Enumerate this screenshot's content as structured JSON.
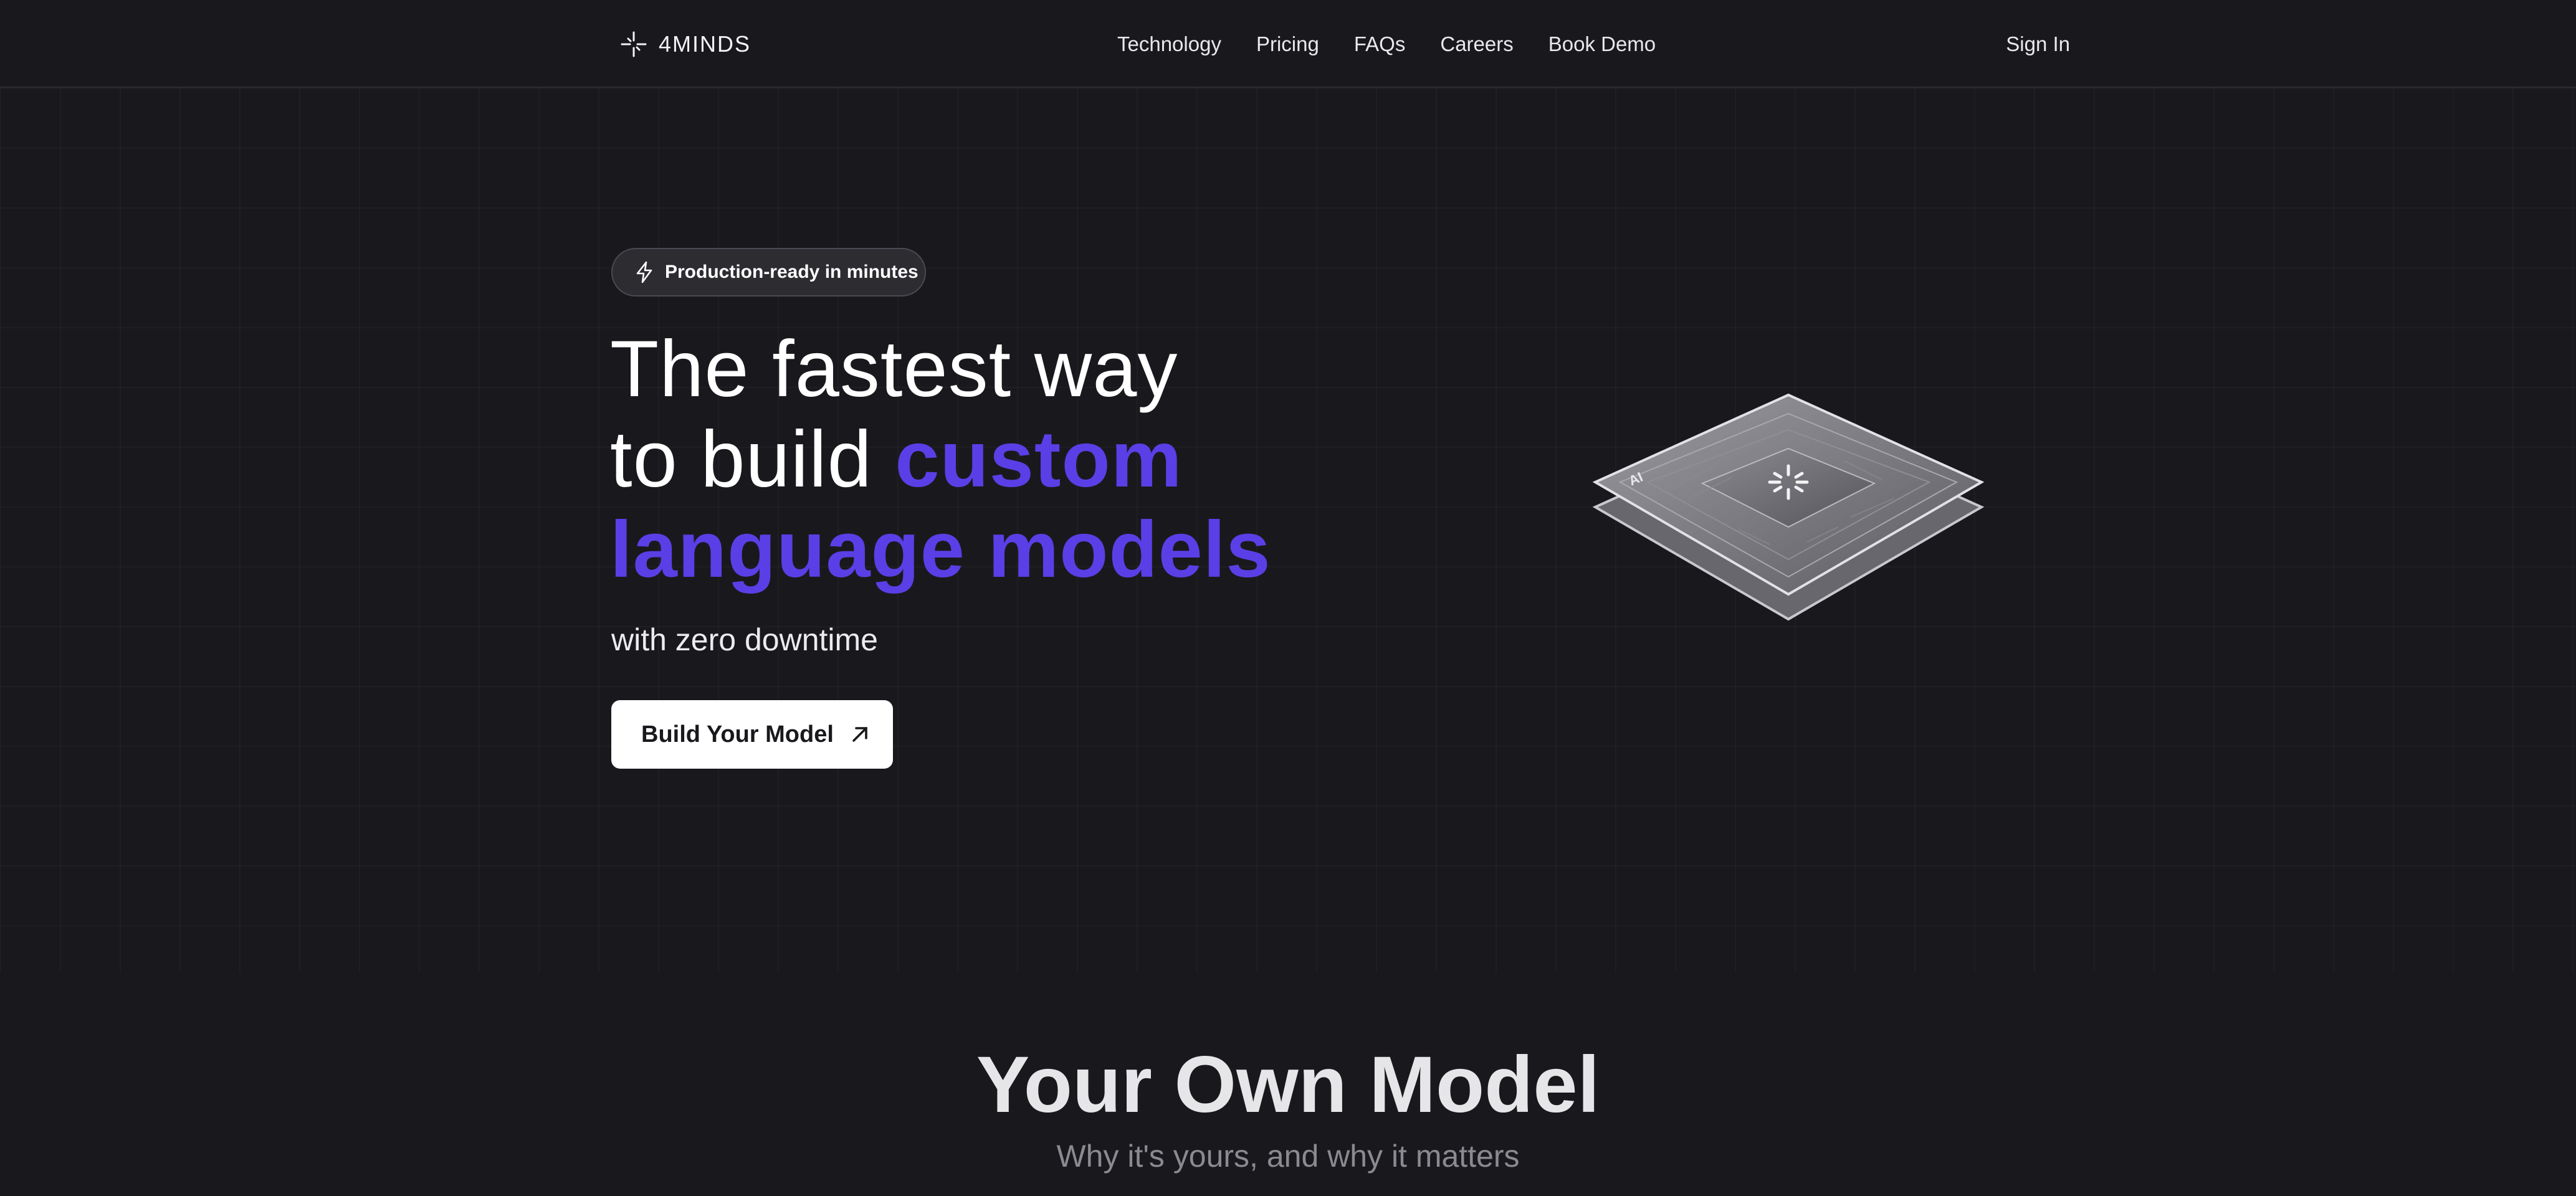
{
  "header": {
    "brand": "4MINDS",
    "nav": [
      "Technology",
      "Pricing",
      "FAQs",
      "Careers",
      "Book Demo"
    ],
    "sign_in": "Sign In"
  },
  "hero": {
    "badge": "Production-ready in minutes",
    "headline_line1": "The fastest way",
    "headline_line2_plain": "to build ",
    "headline_line2_accent": "custom",
    "headline_line3_accent": "language models",
    "subheadline": "with zero downtime",
    "cta_label": "Build Your Model",
    "chip_label": "AI"
  },
  "section": {
    "title": "Your Own Model",
    "subtitle": "Why it's yours, and why it matters"
  },
  "colors": {
    "background": "#19191d",
    "accent": "#5a3fe6",
    "button": "#ffffff"
  },
  "icons": {
    "logo": "sparkle-icon",
    "badge": "lightning-bolt-icon",
    "cta": "arrow-up-right-icon"
  }
}
